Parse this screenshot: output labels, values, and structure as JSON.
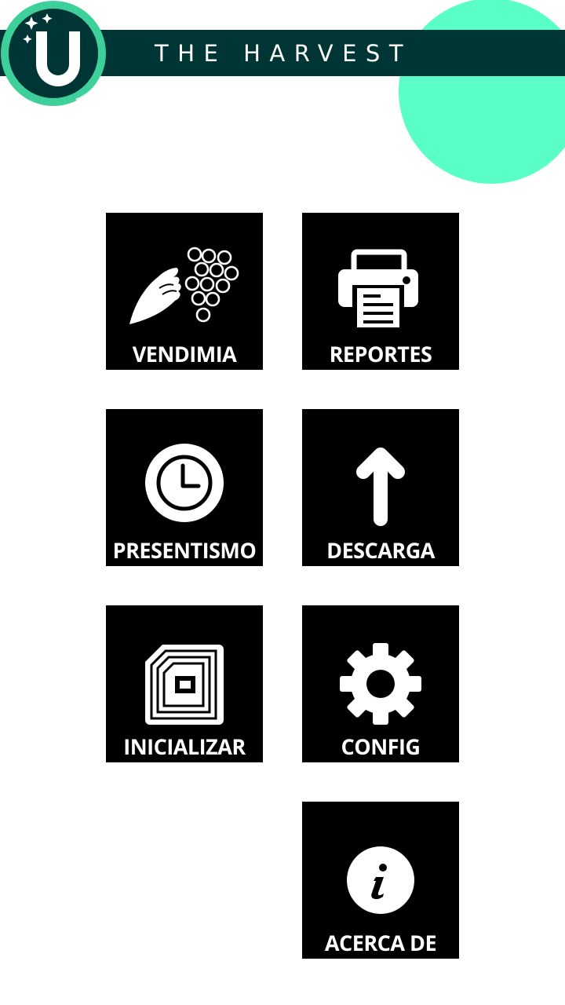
{
  "app": {
    "title": "THE HARVEST",
    "logo_letter": "U",
    "colors": {
      "header": "#003535",
      "accent": "#5affc8",
      "logo_ring": "#3dd09a",
      "tile": "#000000",
      "tile_text": "#ffffff"
    }
  },
  "menu": {
    "vendimia": {
      "label": "VENDIMIA",
      "icon": "hand-grapes-icon"
    },
    "reportes": {
      "label": "REPORTES",
      "icon": "printer-icon"
    },
    "presentismo": {
      "label": "PRESENTISMO",
      "icon": "clock-icon"
    },
    "descarga": {
      "label": "DESCARGA",
      "icon": "arrow-up-icon"
    },
    "inicializar": {
      "label": "INICIALIZAR",
      "icon": "nfc-tag-icon"
    },
    "config": {
      "label": "CONFIG",
      "icon": "gear-icon"
    },
    "acerca": {
      "label": "ACERCA DE",
      "icon": "info-icon"
    }
  }
}
